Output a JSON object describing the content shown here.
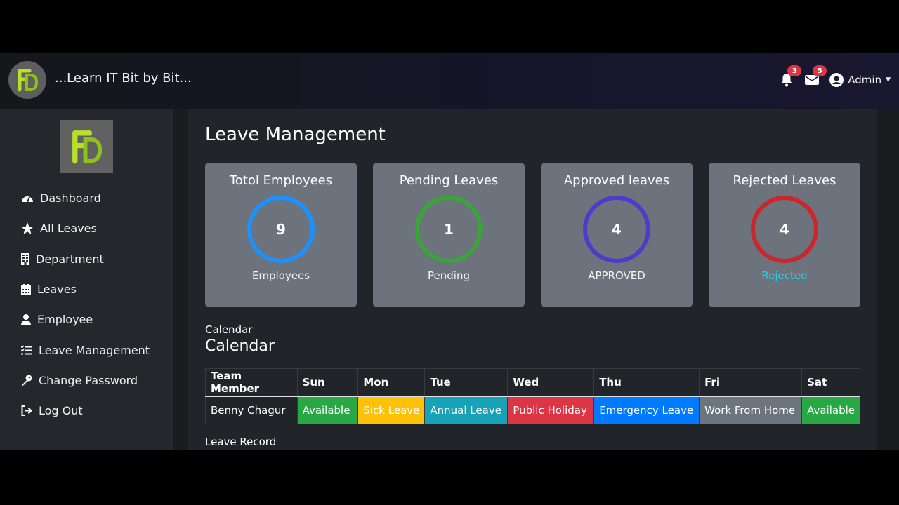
{
  "header": {
    "brand": "...Learn IT Bit by Bit...",
    "notifications_count": "3",
    "messages_count": "5",
    "user_label": "Admin"
  },
  "sidebar": {
    "items": [
      {
        "label": "Dashboard",
        "icon": "dashboard-icon"
      },
      {
        "label": "All Leaves",
        "icon": "star-icon"
      },
      {
        "label": "Department",
        "icon": "building-icon"
      },
      {
        "label": "Leaves",
        "icon": "calendar-icon"
      },
      {
        "label": "Employee",
        "icon": "user-icon"
      },
      {
        "label": "Leave Management",
        "icon": "checklist-icon"
      },
      {
        "label": "Change Password",
        "icon": "key-icon"
      },
      {
        "label": "Log Out",
        "icon": "logout-icon"
      }
    ]
  },
  "main": {
    "title": "Leave Management",
    "cards": [
      {
        "title": "Totol Employees",
        "value": "9",
        "subtitle": "Employees",
        "ring_color": "#1e90ff",
        "subtitle_color": "#f5f5f5"
      },
      {
        "title": "Pending Leaves",
        "value": "1",
        "subtitle": "Pending",
        "ring_color": "#3aa33a",
        "subtitle_color": "#f5f5f5"
      },
      {
        "title": "Approved leaves",
        "value": "4",
        "subtitle": "APPROVED",
        "ring_color": "#4a3ec9",
        "subtitle_color": "#f5f5f5"
      },
      {
        "title": "Rejected Leaves",
        "value": "4",
        "subtitle": "Rejected",
        "ring_color": "#c9262d",
        "subtitle_color": "#1fd6e6"
      }
    ],
    "calendar_caption": "Calendar",
    "calendar_heading": "Calendar",
    "calendar": {
      "headers": [
        "Team Member",
        "Sun",
        "Mon",
        "Tue",
        "Wed",
        "Thu",
        "Fri",
        "Sat"
      ],
      "rows": [
        {
          "member": "Benny Chagur",
          "days": [
            {
              "label": "Available",
              "bg": "#28a745",
              "fg": "#ffffff"
            },
            {
              "label": "Sick Leave",
              "bg": "#ffc107",
              "fg": "#ffffff"
            },
            {
              "label": "Annual Leave",
              "bg": "#17a2b8",
              "fg": "#ffffff"
            },
            {
              "label": "Public Holiday",
              "bg": "#dc3545",
              "fg": "#ffffff"
            },
            {
              "label": "Emergency Leave",
              "bg": "#007bff",
              "fg": "#ffffff"
            },
            {
              "label": "Work From Home",
              "bg": "#6c757d",
              "fg": "#ffffff"
            },
            {
              "label": "Available",
              "bg": "#28a745",
              "fg": "#ffffff"
            }
          ]
        }
      ]
    },
    "leave_record_label": "Leave Record"
  }
}
